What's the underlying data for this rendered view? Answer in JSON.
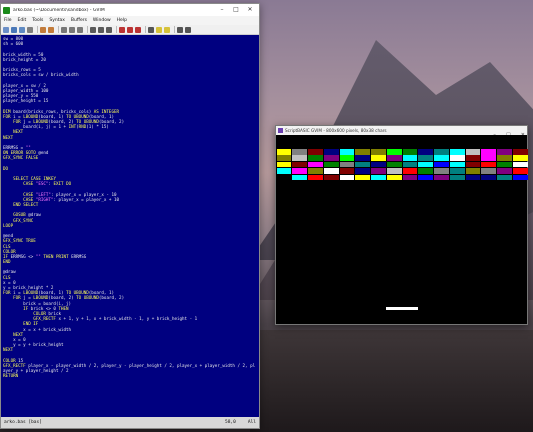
{
  "editor_window": {
    "title": "arko.bas (~\\Documents\\sandbox) - GVIM",
    "menu": [
      "File",
      "Edit",
      "Tools",
      "Syntax",
      "Buffers",
      "Window",
      "Help"
    ],
    "status_file": "arko.bas [bas]",
    "status_pos": "58,0",
    "status_pct": "All",
    "code_lines": [
      "sw = 800",
      "sh = 600",
      "",
      "brick_width = 50",
      "brick_height = 20",
      "",
      "bricks_rows = 5",
      "bricks_cols = sw / brick_width",
      "",
      "player_x = sw / 2",
      "player_width = 100",
      "player_y = 550",
      "player_height = 15",
      "",
      "DIM board(bricks_rows, bricks_cols) AS INTEGER",
      "FOR i = LBOUND(board, 1) TO UBOUND(board, 1)",
      "    FOR j = LBOUND(board, 2) TO UBOUND(board, 2)",
      "        board(i, j) = 1 + INT(RND(1) * 15)",
      "    NEXT",
      "NEXT",
      "",
      "ERRMSG = \"\"",
      "ON ERROR GOTO @end",
      "GFX_SYNC FALSE",
      "",
      "DO",
      "",
      "    SELECT CASE INKEY",
      "        CASE \"ESC\": EXIT DO",
      "",
      "        CASE \"LEFT\": player_x = player_x - 10",
      "        CASE \"RIGHT\": player_x = player_x + 10",
      "    END SELECT",
      "",
      "    GOSUB @draw",
      "    GFX_SYNC",
      "LOOP",
      "",
      "@end",
      "GFX_SYNC TRUE",
      "CLS",
      "COLOR",
      "IF ERRMSG <> \"\" THEN PRINT ERRMSG",
      "END",
      "",
      "@draw",
      "CLS",
      "x = 0",
      "y = brick_height * 2",
      "FOR i = LBOUND(board, 1) TO UBOUND(board, 1)",
      "    FOR j = LBOUND(board, 2) TO UBOUND(board, 2)",
      "        brick = board(i, j)",
      "        IF brick <> 0 THEN",
      "            COLOR brick",
      "            GFX_RECTF x + 1, y + 1, x + brick_width - 1, y + brick_height - 1",
      "        END IF",
      "        x = x + brick_width",
      "    NEXT",
      "    x = 0",
      "    y = y + brick_height",
      "NEXT",
      "",
      "COLOR 15",
      "GFX_RECTF player_x - player_width / 2, player_y - player_height / 2, player_x + player_width / 2, pl",
      "ayer_y + player_height / 2",
      "RETURN"
    ]
  },
  "game_window": {
    "title": "ScriptBASIC GVIM - 800x600 pixels, 80x38 chars",
    "brick_colors": [
      [
        "#ffff00",
        "#808080",
        "#800000",
        "#000080",
        "#00ffff",
        "#808000",
        "#808000",
        "#00ff00",
        "#008000",
        "#000080",
        "#008080",
        "#00ffff",
        "#c0c0c0",
        "#ff00ff",
        "#800080",
        "#800000"
      ],
      [
        "#808000",
        "#c0c0c0",
        "#008000",
        "#800080",
        "#00ff00",
        "#000080",
        "#ffff00",
        "#800080",
        "#00ffff",
        "#008080",
        "#00ffff",
        "#ffffff",
        "#800000",
        "#ff00ff",
        "#808000",
        "#ffff00"
      ],
      [
        "#ffff00",
        "#800000",
        "#ff00ff",
        "#008000",
        "#808080",
        "#008080",
        "#000080",
        "#008000",
        "#008080",
        "#00ffff",
        "#0000ff",
        "#00ffff",
        "#800000",
        "#ff0000",
        "#008000",
        "#ffffff"
      ],
      [
        "#00ffff",
        "#ff00ff",
        "#808000",
        "#ffffff",
        "#800000",
        "#000080",
        "#800080",
        "#c0c0c0",
        "#ff0000",
        "#008000",
        "#808080",
        "#008080",
        "#808000",
        "#808080",
        "#800080",
        "#ff0000"
      ],
      [
        "#000000",
        "#00ffff",
        "#ff0000",
        "#800000",
        "#ffffff",
        "#ffff00",
        "#00ffff",
        "#ffff00",
        "#800080",
        "#0000ff",
        "#800080",
        "#008080",
        "#000080",
        "#000080",
        "#008080",
        "#0000ff"
      ]
    ]
  }
}
